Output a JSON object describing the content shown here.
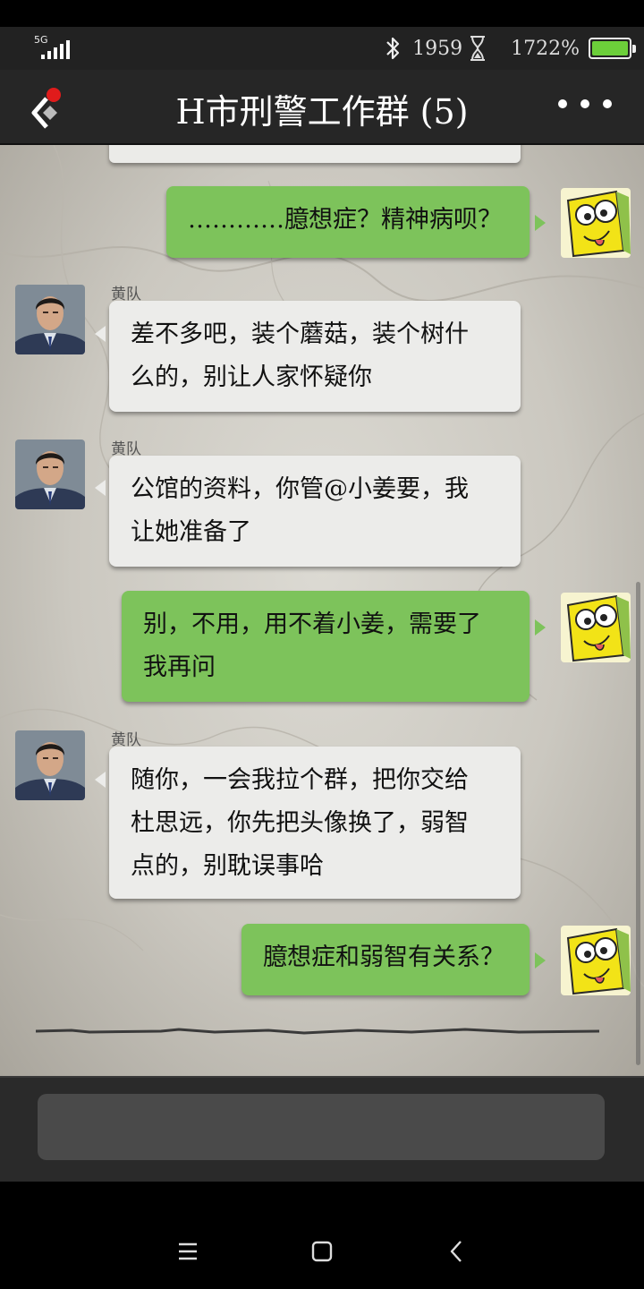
{
  "status_bar": {
    "network": "5G",
    "steps": "1959",
    "battery_percent": "1722%",
    "battery_level": 1.0
  },
  "header": {
    "title": "H市刑警工作群 (5)"
  },
  "messages": [
    {
      "side": "out",
      "text": "…………臆想症？精神病呗？"
    },
    {
      "side": "in",
      "sender": "黄队",
      "lines": [
        "差不多吧，装个蘑菇，装个树什",
        "么的，别让人家怀疑你"
      ]
    },
    {
      "side": "in",
      "sender": "黄队",
      "lines": [
        "公馆的资料，你管@小姜要，我",
        "让她准备了"
      ]
    },
    {
      "side": "out",
      "lines": [
        "别，不用，用不着小姜，需要了",
        "我再问"
      ]
    },
    {
      "side": "in",
      "sender": "黄队",
      "lines": [
        "随你，一会我拉个群，把你交给",
        "杜思远，你先把头像换了，弱智",
        "点的，别耽误事哈"
      ]
    },
    {
      "side": "out",
      "text": "臆想症和弱智有关系？"
    }
  ],
  "icons": {
    "back": "back-chevron-icon",
    "more": "more-dots-icon",
    "bluetooth": "bluetooth-icon",
    "hourglass": "hourglass-icon",
    "nav_menu": "menu-icon",
    "nav_home": "home-icon",
    "nav_back": "back-icon"
  },
  "colors": {
    "out_bubble": "#7dc35b",
    "in_bubble": "#ececea",
    "unread_dot": "#e01b1b",
    "battery": "#6ccf3a"
  }
}
